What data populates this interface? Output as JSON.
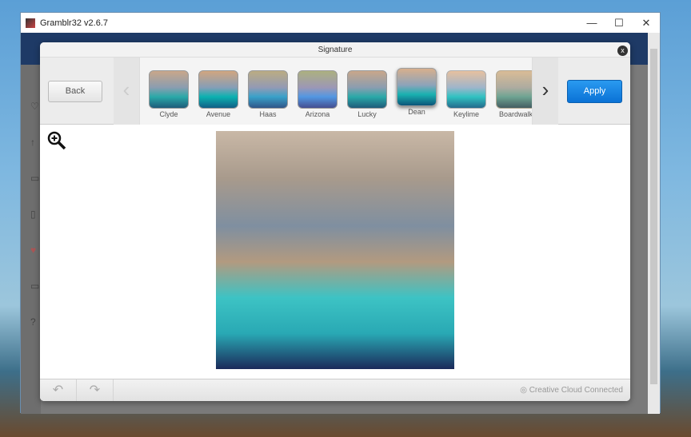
{
  "window": {
    "title": "Gramblr32 v2.6.7",
    "minimize": "—",
    "maximize": "☐",
    "close": "✕"
  },
  "modal": {
    "title": "Signature",
    "close": "x",
    "back": "Back",
    "apply": "Apply",
    "prev": "‹",
    "next": "›",
    "filters": [
      {
        "label": "Clyde"
      },
      {
        "label": "Avenue"
      },
      {
        "label": "Haas"
      },
      {
        "label": "Arizona"
      },
      {
        "label": "Lucky"
      },
      {
        "label": "Dean",
        "selected": true
      },
      {
        "label": "Keylime"
      },
      {
        "label": "Boardwalk"
      }
    ],
    "footer": {
      "undo": "↶",
      "redo": "↷",
      "status": "Creative Cloud Connected"
    }
  },
  "colors": {
    "apply": "#0a7ee0",
    "app_header": "#1e3a66"
  }
}
